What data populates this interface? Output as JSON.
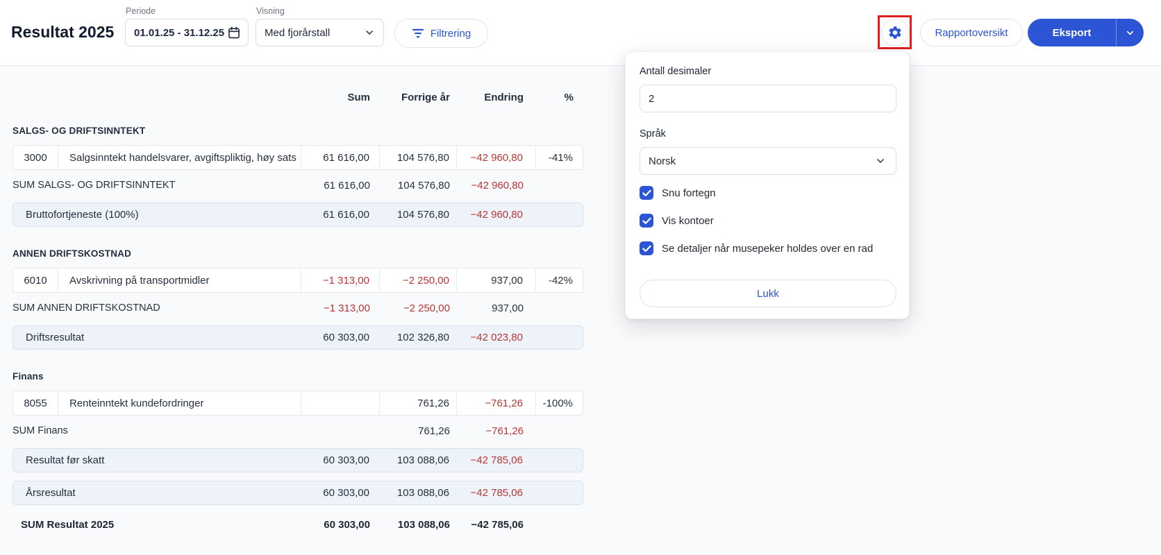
{
  "header": {
    "title": "Resultat 2025",
    "period_label": "Periode",
    "period_value": "01.01.25 - 31.12.25",
    "view_label": "Visning",
    "view_value": "Med fjorårstall",
    "filter_label": "Filtrering",
    "report_overview_label": "Rapportoversikt",
    "export_label": "Eksport"
  },
  "settings_popover": {
    "decimals_label": "Antall desimaler",
    "decimals_value": "2",
    "language_label": "Språk",
    "language_value": "Norsk",
    "options": [
      {
        "label": "Snu fortegn",
        "checked": true
      },
      {
        "label": "Vis kontoer",
        "checked": true
      },
      {
        "label": "Se detaljer når musepeker holdes over en rad",
        "checked": true
      }
    ],
    "close_label": "Lukk"
  },
  "table": {
    "columns": {
      "sum": "Sum",
      "prev": "Forrige år",
      "change": "Endring",
      "pct": "%"
    },
    "blocks": [
      {
        "type": "section",
        "label": "SALGS- OG DRIFTSINNTEKT"
      },
      {
        "type": "account",
        "number": "3000",
        "name": "Salgsinntekt handelsvarer, avgiftspliktig, høy sats",
        "sum": "61 616,00",
        "prev": "104 576,80",
        "change": "−42 960,80",
        "pct": "-41%"
      },
      {
        "type": "sum",
        "label": "SUM SALGS- OG DRIFTSINNTEKT",
        "sum": "61 616,00",
        "prev": "104 576,80",
        "change": "−42 960,80"
      },
      {
        "type": "total",
        "label": "Bruttofortjeneste (100%)",
        "sum": "61 616,00",
        "prev": "104 576,80",
        "change": "−42 960,80"
      },
      {
        "type": "section",
        "label": "ANNEN DRIFTSKOSTNAD"
      },
      {
        "type": "account",
        "number": "6010",
        "name": "Avskrivning på transportmidler",
        "sum": "−1 313,00",
        "prev": "−2 250,00",
        "change": "937,00",
        "pct": "-42%"
      },
      {
        "type": "sum",
        "label": "SUM ANNEN DRIFTSKOSTNAD",
        "sum": "−1 313,00",
        "prev": "−2 250,00",
        "change": "937,00"
      },
      {
        "type": "total",
        "label": "Driftsresultat",
        "sum": "60 303,00",
        "prev": "102 326,80",
        "change": "−42 023,80"
      },
      {
        "type": "section",
        "label": "Finans"
      },
      {
        "type": "account",
        "number": "8055",
        "name": "Renteinntekt kundefordringer",
        "sum": "",
        "prev": "761,26",
        "change": "−761,26",
        "pct": "-100%"
      },
      {
        "type": "sum",
        "label": "SUM Finans",
        "sum": "",
        "prev": "761,26",
        "change": "−761,26"
      },
      {
        "type": "total",
        "label": "Resultat før skatt",
        "sum": "60 303,00",
        "prev": "103 088,06",
        "change": "−42 785,06"
      },
      {
        "type": "total",
        "label": "Årsresultat",
        "sum": "60 303,00",
        "prev": "103 088,06",
        "change": "−42 785,06"
      },
      {
        "type": "grand",
        "label": "SUM Resultat 2025",
        "sum": "60 303,00",
        "prev": "103 088,06",
        "change": "−42 785,06"
      }
    ]
  },
  "colors": {
    "accent_blue": "#2b55d5",
    "negative_red": "#b63636",
    "highlight_row_bg": "#eef3f9",
    "annotation_red": "#dd1f1f",
    "header_border": "#e6e9ed"
  }
}
